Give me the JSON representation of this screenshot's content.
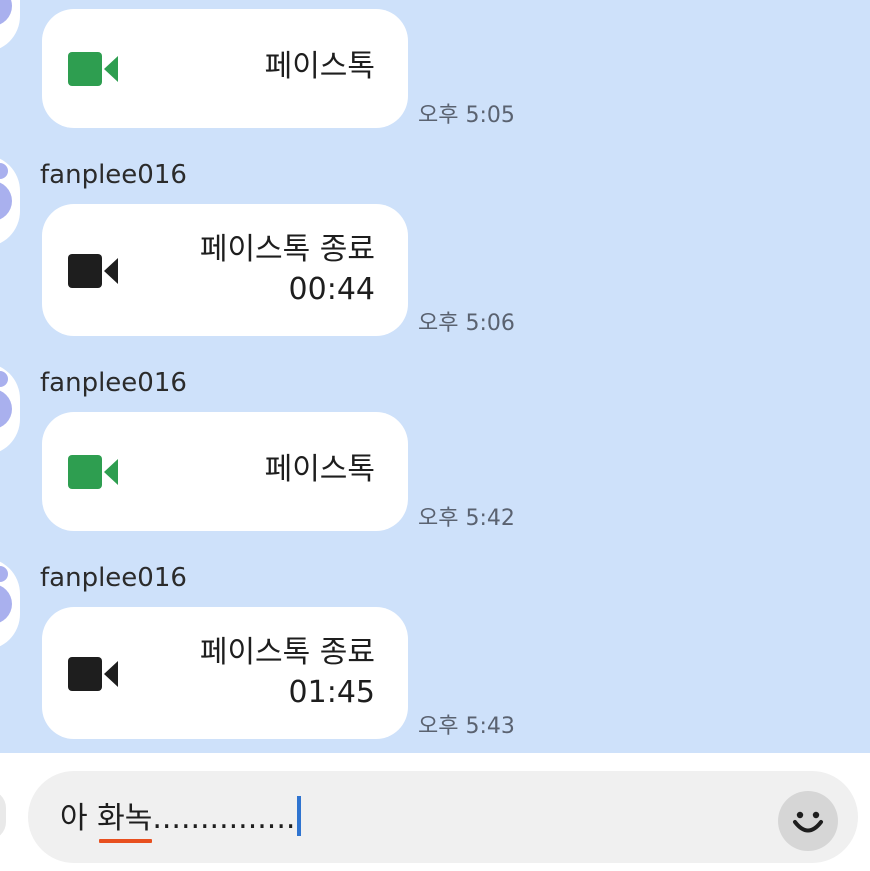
{
  "messages": [
    {
      "sender": "",
      "call_label": "페이스톡",
      "duration": "",
      "time": "오후 5:05",
      "icon": "video-camera-icon",
      "icon_color": "#2e9e50"
    },
    {
      "sender": "fanplee016",
      "call_label": "페이스톡 종료",
      "duration": "00:44",
      "time": "오후 5:06",
      "icon": "video-camera-icon",
      "icon_color": "#1e1e1e"
    },
    {
      "sender": "fanplee016",
      "call_label": "페이스톡",
      "duration": "",
      "time": "오후 5:42",
      "icon": "video-camera-icon",
      "icon_color": "#2e9e50"
    },
    {
      "sender": "fanplee016",
      "call_label": "페이스톡 종료",
      "duration": "01:45",
      "time": "오후 5:43",
      "icon": "video-camera-icon",
      "icon_color": "#1e1e1e"
    }
  ],
  "composer": {
    "text_prefix": "아 ",
    "text_underlined": "화녹",
    "text_suffix": "...............",
    "emoji_icon": "smiley-face-icon"
  },
  "colors": {
    "chat_background": "#cee1fa",
    "bubble": "#ffffff",
    "spellcheck_underline": "#e8501f",
    "caret": "#2f74d0"
  }
}
